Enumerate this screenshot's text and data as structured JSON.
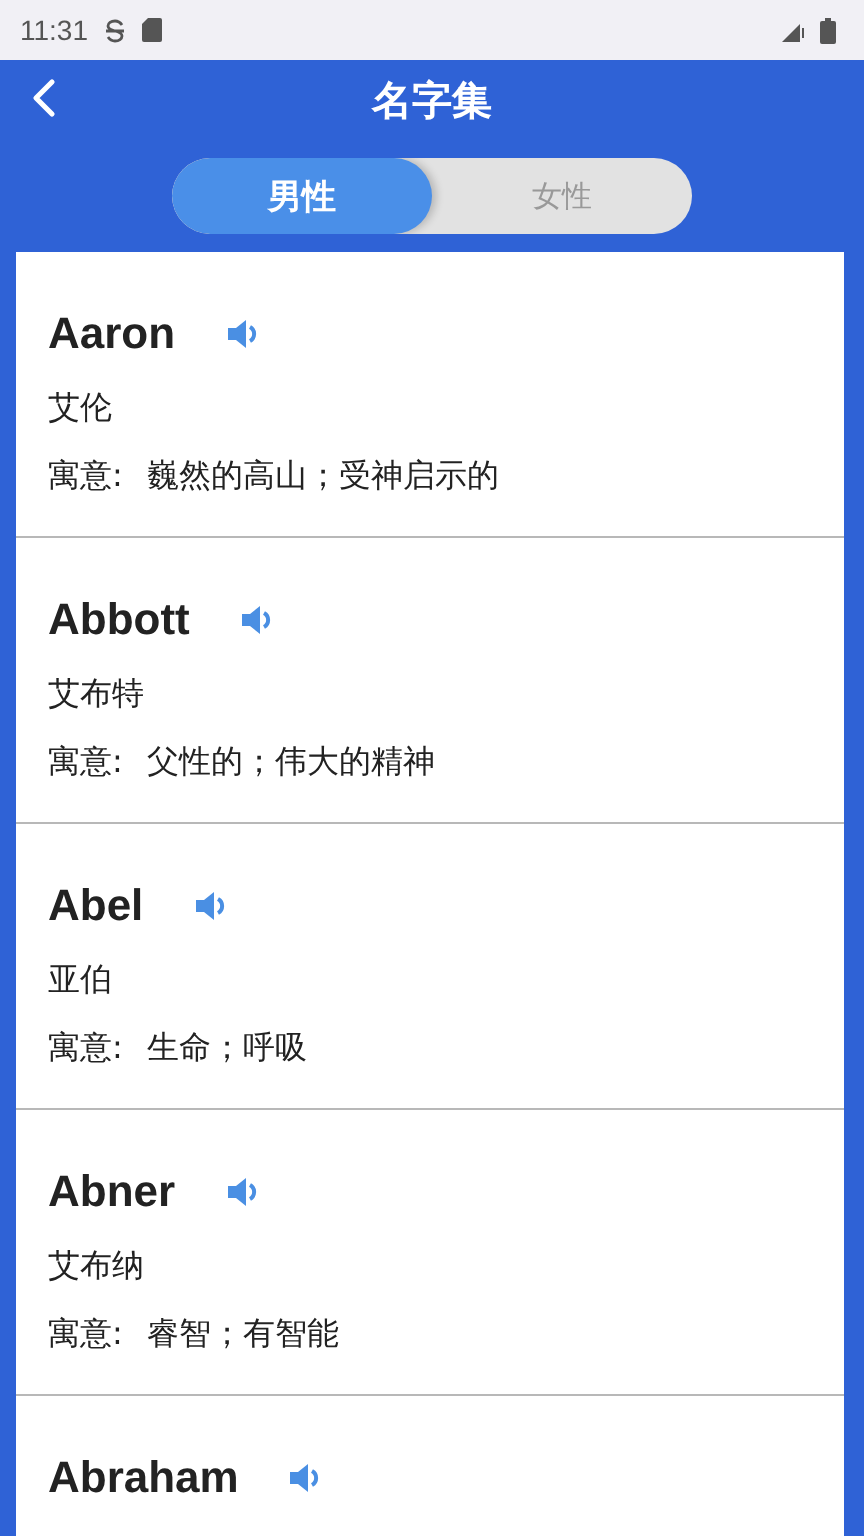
{
  "status_bar": {
    "time": "11:31"
  },
  "header": {
    "title": "名字集"
  },
  "tabs": [
    {
      "label": "男性",
      "selected": true
    },
    {
      "label": "女性",
      "selected": false
    }
  ],
  "names": [
    {
      "name": "Aaron",
      "chinese": "艾伦",
      "meaning_label": "寓意:",
      "meaning": "巍然的高山；受神启示的"
    },
    {
      "name": "Abbott",
      "chinese": "艾布特",
      "meaning_label": "寓意:",
      "meaning": "父性的；伟大的精神"
    },
    {
      "name": "Abel",
      "chinese": "亚伯",
      "meaning_label": "寓意:",
      "meaning": "生命；呼吸"
    },
    {
      "name": "Abner",
      "chinese": "艾布纳",
      "meaning_label": "寓意:",
      "meaning": "睿智；有智能"
    },
    {
      "name": "Abraham"
    }
  ]
}
